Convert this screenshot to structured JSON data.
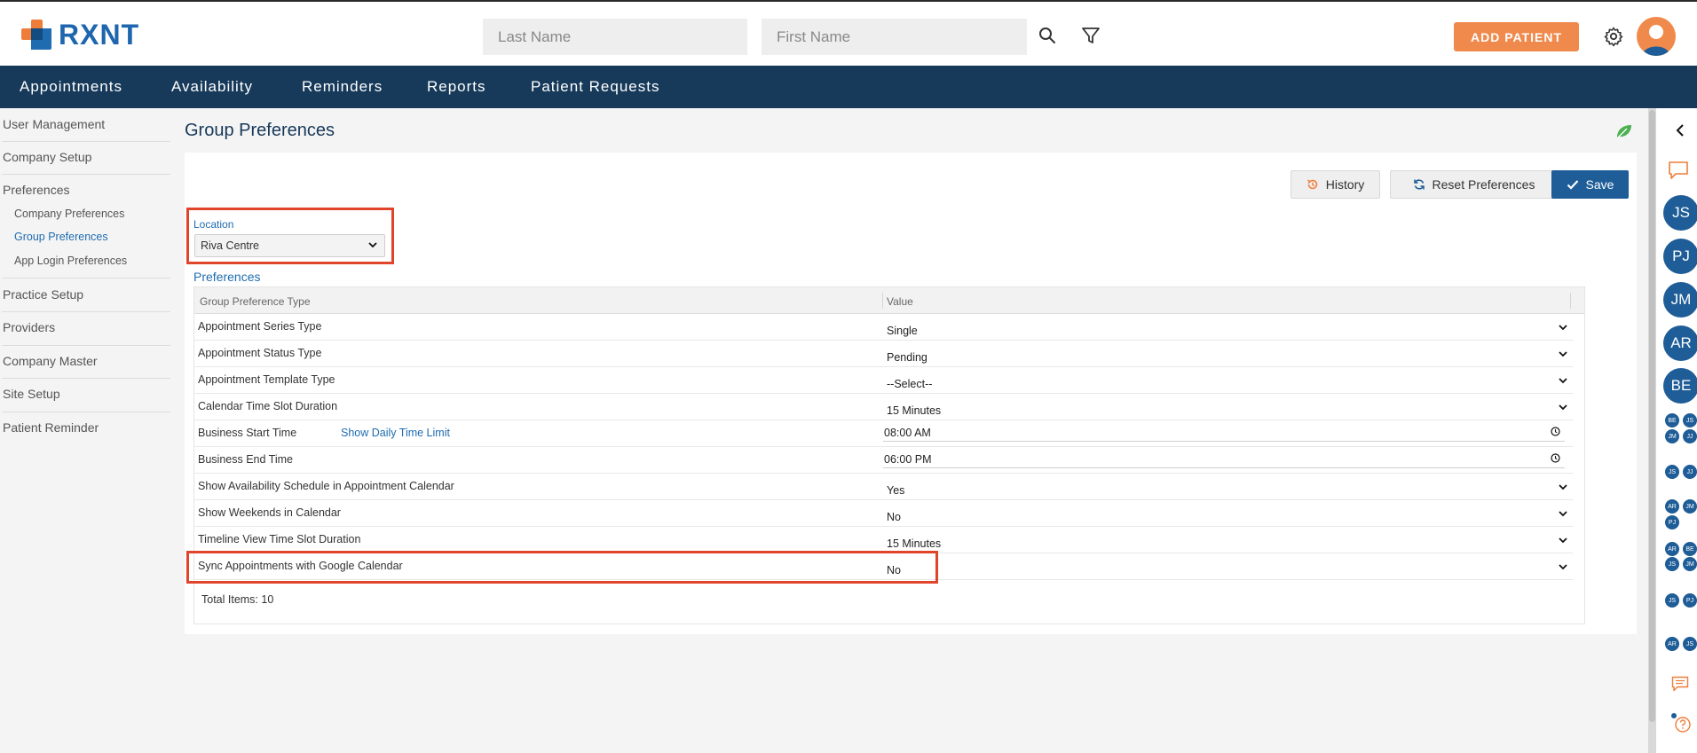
{
  "header": {
    "logo_text": "RXNT",
    "last_name_placeholder": "Last Name",
    "first_name_placeholder": "First Name",
    "add_patient_label": "ADD PATIENT"
  },
  "nav": {
    "items": [
      "Appointments",
      "Availability",
      "Reminders",
      "Reports",
      "Patient Requests"
    ]
  },
  "sidebar": {
    "items": [
      "User Management",
      "Company Setup",
      "Preferences",
      "Company Preferences",
      "Group Preferences",
      "App Login Preferences",
      "Practice Setup",
      "Providers",
      "Company Master",
      "Site Setup",
      "Patient Reminder"
    ]
  },
  "main": {
    "title": "Group Preferences",
    "history_label": "History",
    "reset_label": "Reset Preferences",
    "save_label": "Save",
    "location_label": "Location",
    "location_value": "Riva Centre",
    "preferences_label": "Preferences",
    "col_type": "Group Preference Type",
    "col_value": "Value",
    "show_daily_limit": "Show Daily Time Limit",
    "rows": [
      {
        "name": "Appointment Series Type",
        "value": "Single"
      },
      {
        "name": "Appointment Status Type",
        "value": "Pending"
      },
      {
        "name": "Appointment Template Type",
        "value": "--Select--"
      },
      {
        "name": "Calendar Time Slot Duration",
        "value": "15 Minutes"
      },
      {
        "name": "Business Start Time",
        "value": "08:00  AM"
      },
      {
        "name": "Business End Time",
        "value": "06:00  PM"
      },
      {
        "name": "Show Availability Schedule in Appointment Calendar",
        "value": "Yes"
      },
      {
        "name": "Show Weekends in Calendar",
        "value": "No"
      },
      {
        "name": "Timeline View Time Slot Duration",
        "value": "15 Minutes"
      },
      {
        "name": "Sync Appointments with Google Calendar",
        "value": "No"
      }
    ],
    "total_items": "Total Items: 10"
  },
  "rail": {
    "big": [
      "JS",
      "PJ",
      "JM",
      "AR",
      "BE"
    ],
    "small": [
      [
        "BE",
        "JS"
      ],
      [
        "JM",
        "JJ"
      ],
      [
        "JS",
        "JJ"
      ],
      [
        "AR",
        "JM"
      ],
      [
        "PJ"
      ],
      [
        "AR",
        "BE"
      ],
      [
        "JS",
        "JM"
      ],
      [
        "JS",
        "PJ"
      ],
      [
        "AR",
        "JS"
      ]
    ]
  },
  "colors": {
    "nav_bg": "#173a5b",
    "accent_orange": "#ef8a4c",
    "primary_blue": "#1e5d97",
    "highlight_red": "#e0442a"
  }
}
